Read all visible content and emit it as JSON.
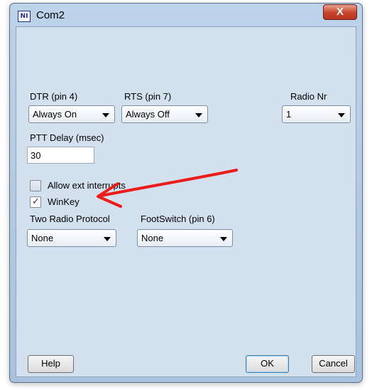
{
  "window": {
    "title": "Com2",
    "close_label": "X",
    "icon_text": "NI"
  },
  "dtr": {
    "label": "DTR (pin 4)",
    "value": "Always On"
  },
  "rts": {
    "label": "RTS (pin 7)",
    "value": "Always Off"
  },
  "radio_nr": {
    "label": "Radio Nr",
    "value": "1"
  },
  "ptt_delay": {
    "label": "PTT Delay  (msec)",
    "value": "30"
  },
  "allow_ext_interrupts": {
    "label": "Allow ext interrupts",
    "checked": false
  },
  "winkey": {
    "label": "WinKey",
    "checked": true
  },
  "two_radio_protocol": {
    "label": "Two Radio Protocol",
    "value": "None"
  },
  "footswitch": {
    "label": "FootSwitch (pin 6)",
    "value": "None"
  },
  "buttons": {
    "help": "Help",
    "ok": "OK",
    "cancel": "Cancel"
  },
  "annotation": {
    "arrow_color": "#ee1b1b"
  }
}
